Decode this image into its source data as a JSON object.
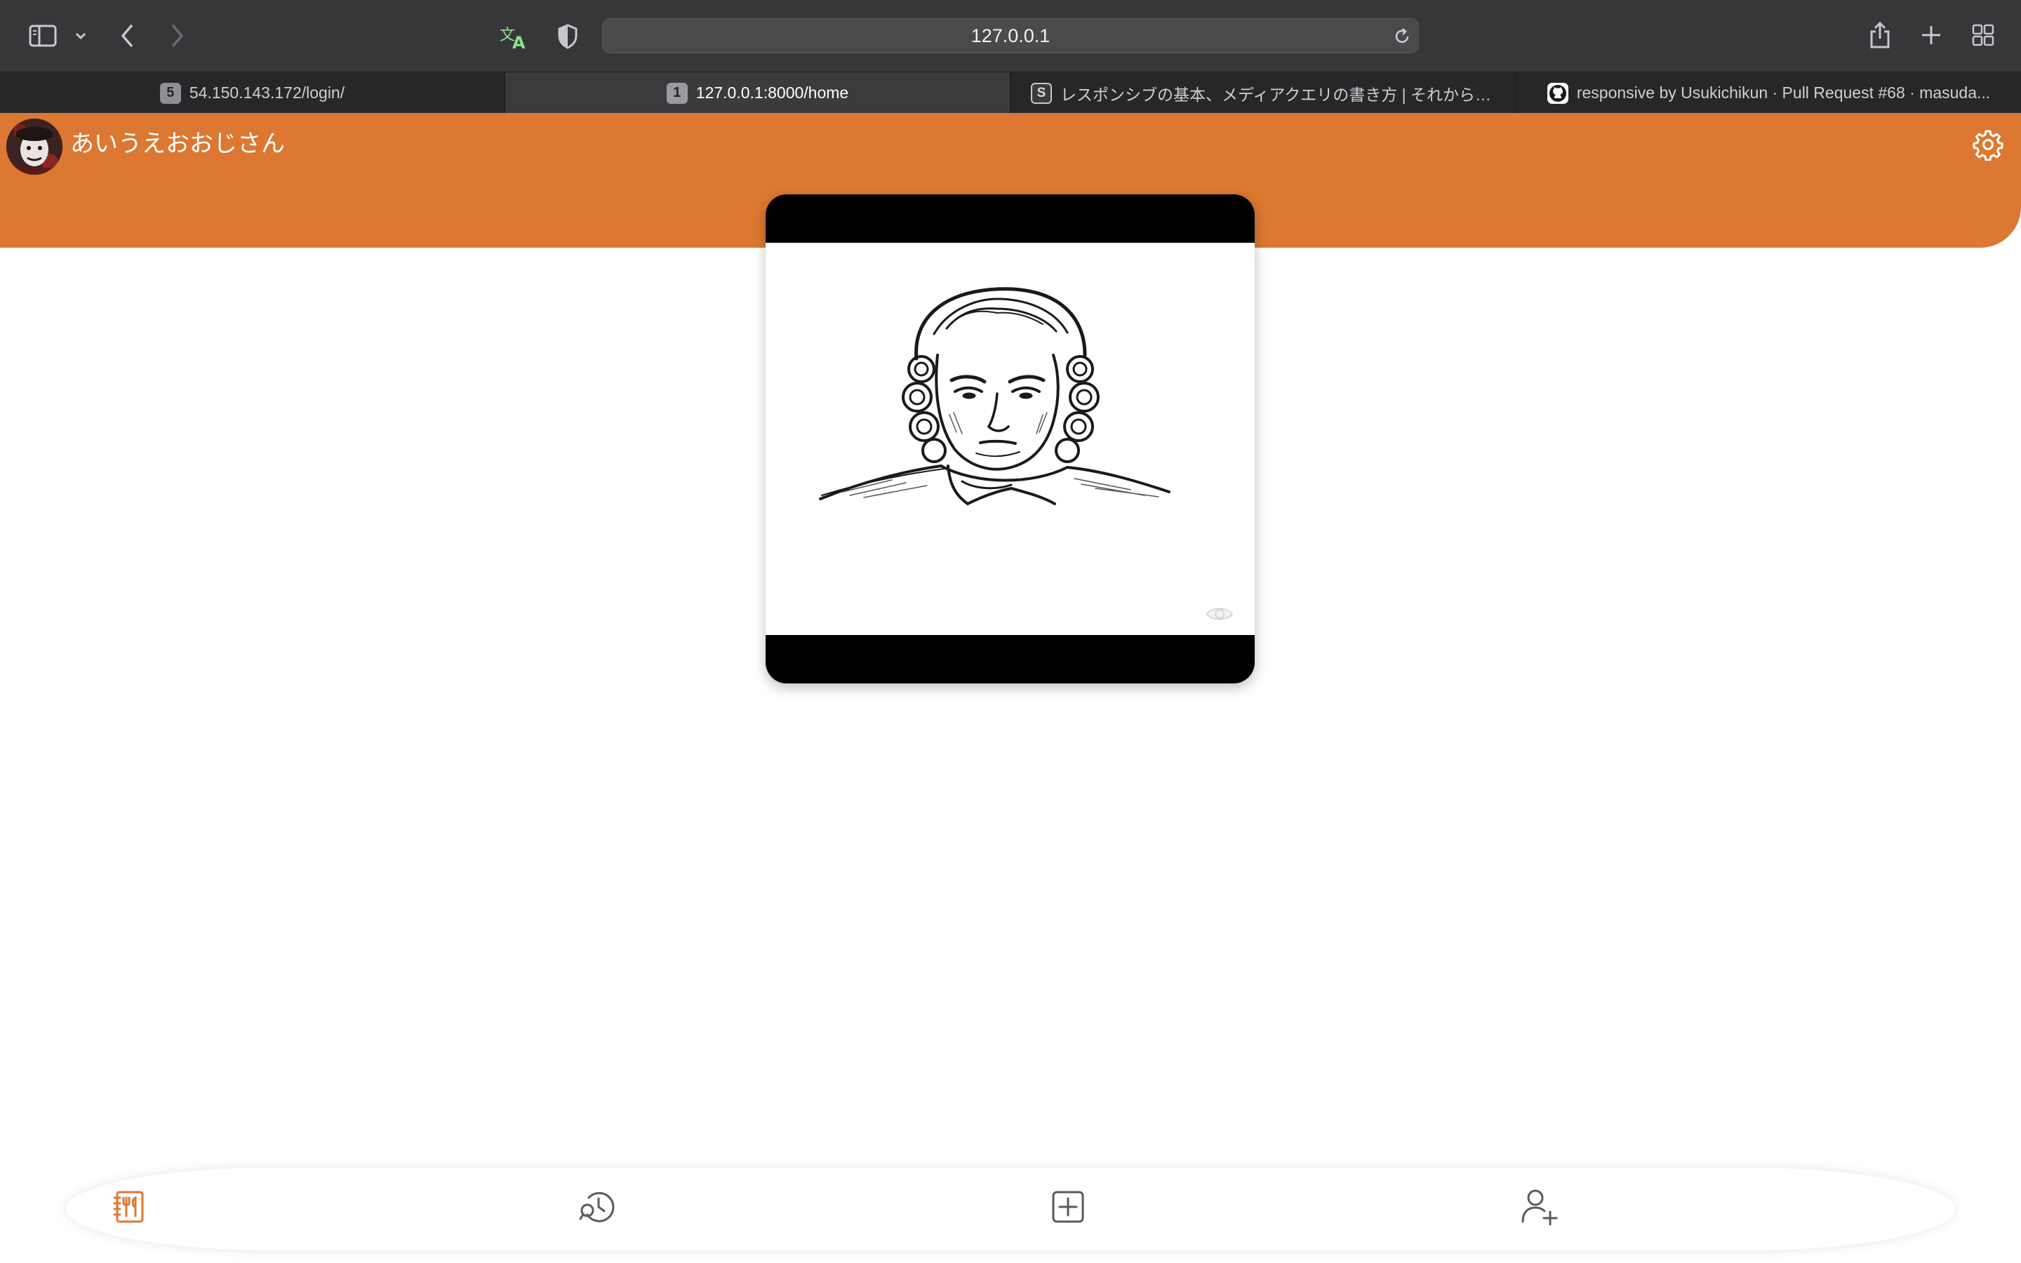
{
  "browser": {
    "url": "127.0.0.1",
    "tabs": [
      {
        "badge": "5",
        "title": "54.150.143.172/login/",
        "active": false
      },
      {
        "badge": "1",
        "title": "127.0.0.1:8000/home",
        "active": true
      },
      {
        "badge": "S",
        "title": "レスポンシブの基本、メディアクエリの書き方 | それからデザイン...",
        "active": false
      },
      {
        "badge": "",
        "title": "responsive by Usukichikun · Pull Request #68 · masuda...",
        "active": false
      }
    ],
    "icons": [
      "sidebar-icon",
      "chevron-down-icon",
      "back-icon",
      "forward-icon",
      "translate-icon",
      "privacy-shield-icon",
      "reload-icon",
      "share-icon",
      "new-tab-icon",
      "tab-overview-icon"
    ]
  },
  "header": {
    "username": "あいうえおおじさん",
    "icons": [
      "avatar",
      "gear-icon"
    ],
    "accent_color": "#dc7831"
  },
  "post": {
    "image": "portrait-engraving",
    "icons": [
      "eye-icon"
    ]
  },
  "bottom_nav": {
    "items": [
      {
        "icon": "menu-book-icon",
        "active": true
      },
      {
        "icon": "history-search-icon",
        "active": false
      },
      {
        "icon": "add-square-icon",
        "active": false
      },
      {
        "icon": "add-user-icon",
        "active": false
      }
    ],
    "active_color": "#dc7831",
    "inactive_color": "#5a5a5a"
  }
}
